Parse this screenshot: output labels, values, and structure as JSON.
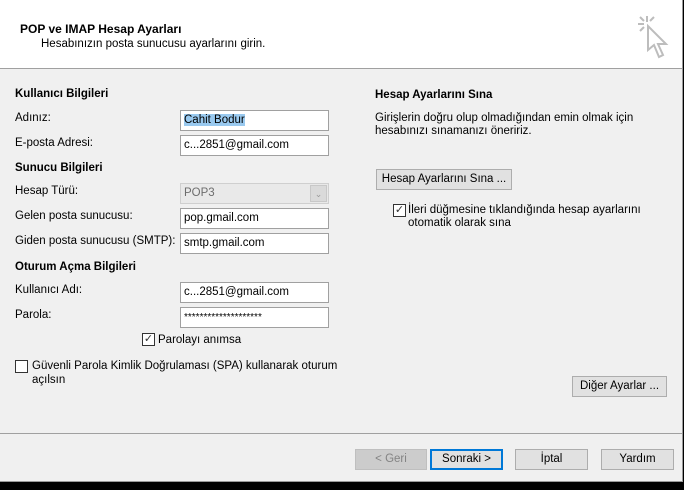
{
  "header": {
    "title": "POP ve IMAP Hesap Ayarları",
    "subtitle": "Hesabınızın posta sunucusu ayarlarını girin."
  },
  "user_info": {
    "heading": "Kullanıcı Bilgileri",
    "name_label": "Adınız:",
    "name_value": "Cahit Bodur",
    "email_label": "E-posta Adresi:",
    "email_value": "c...2851@gmail.com"
  },
  "server_info": {
    "heading": "Sunucu Bilgileri",
    "type_label": "Hesap Türü:",
    "type_value": "POP3",
    "incoming_label": "Gelen posta sunucusu:",
    "incoming_value": "pop.gmail.com",
    "outgoing_label": "Giden posta sunucusu (SMTP):",
    "outgoing_value": "smtp.gmail.com"
  },
  "logon_info": {
    "heading": "Oturum Açma Bilgileri",
    "username_label": "Kullanıcı Adı:",
    "username_value": "c...2851@gmail.com",
    "password_label": "Parola:",
    "password_value": "********************",
    "remember_label": "Parolayı anımsa",
    "remember_checked": true,
    "spa_label_1": "Güvenli Parola Kimlik Doğrulaması (SPA) kullanarak oturum",
    "spa_label_2": "açılsın",
    "spa_checked": false
  },
  "test": {
    "heading": "Hesap Ayarlarını Sına",
    "desc_1": "Girişlerin doğru olup olmadığından emin olmak için",
    "desc_2": "hesabınızı sınamanızı öneririz.",
    "button": "Hesap Ayarlarını Sına ...",
    "auto_label_1": "İleri düğmesine tıklandığında hesap ayarlarını",
    "auto_label_2": "otomatik olarak sına",
    "auto_checked": true
  },
  "more_settings": "Diğer Ayarlar ...",
  "footer": {
    "back": "< Geri",
    "next": "Sonraki >",
    "cancel": "İptal",
    "help": "Yardım"
  },
  "check_glyph": "✓",
  "dropdown_glyph": "⌄"
}
